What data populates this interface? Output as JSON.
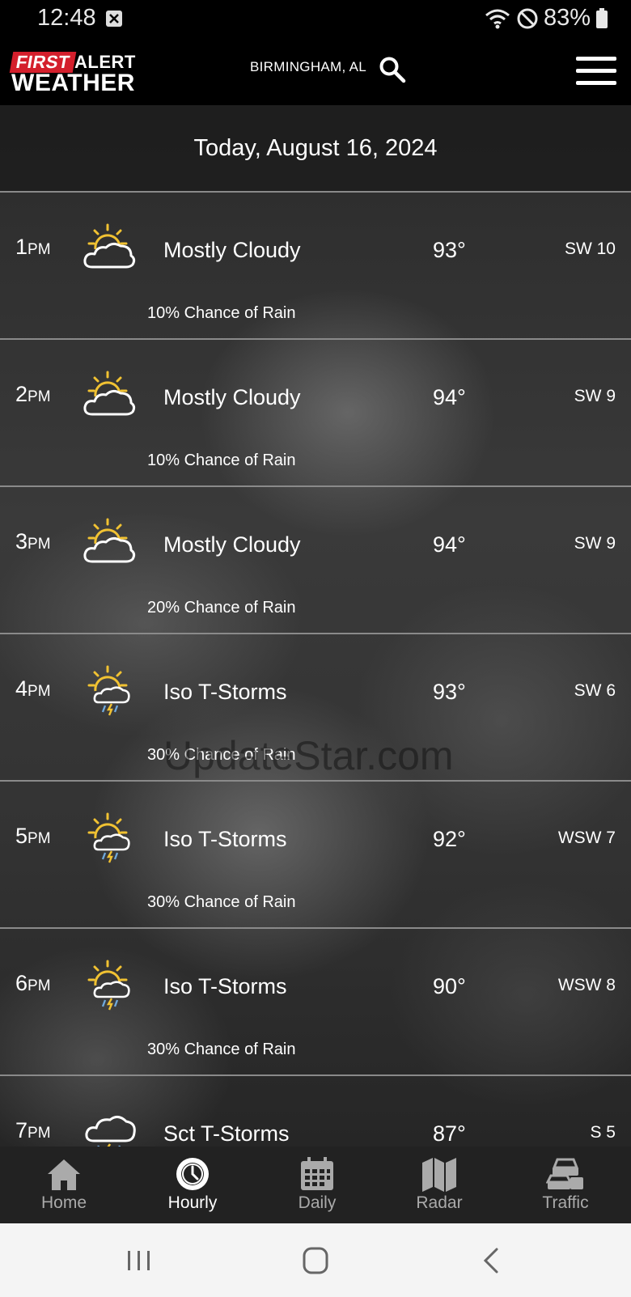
{
  "status": {
    "time": "12:48",
    "battery": "83%",
    "icons": [
      "notification-icon",
      "wifi-icon",
      "do-not-disturb-icon",
      "battery-icon"
    ]
  },
  "header": {
    "logo_first": "FIRST",
    "logo_alert": "ALERT",
    "logo_weather": "WEATHER",
    "location": "BIRMINGHAM, AL",
    "brand_color": "#d41f2c"
  },
  "date": "Today, August 16, 2024",
  "hours": [
    {
      "hour": "1",
      "ampm": "PM",
      "icon": "partly-cloudy-icon",
      "condition": "Mostly Cloudy",
      "temp": "93°",
      "wind": "SW 10",
      "rain": "10% Chance of Rain"
    },
    {
      "hour": "2",
      "ampm": "PM",
      "icon": "partly-cloudy-icon",
      "condition": "Mostly Cloudy",
      "temp": "94°",
      "wind": "SW 9",
      "rain": "10% Chance of Rain"
    },
    {
      "hour": "3",
      "ampm": "PM",
      "icon": "partly-cloudy-icon",
      "condition": "Mostly Cloudy",
      "temp": "94°",
      "wind": "SW 9",
      "rain": "20% Chance of Rain"
    },
    {
      "hour": "4",
      "ampm": "PM",
      "icon": "sun-thunderstorm-icon",
      "condition": "Iso T-Storms",
      "temp": "93°",
      "wind": "SW 6",
      "rain": "30% Chance of Rain"
    },
    {
      "hour": "5",
      "ampm": "PM",
      "icon": "sun-thunderstorm-icon",
      "condition": "Iso T-Storms",
      "temp": "92°",
      "wind": "WSW 7",
      "rain": "30% Chance of Rain"
    },
    {
      "hour": "6",
      "ampm": "PM",
      "icon": "sun-thunderstorm-icon",
      "condition": "Iso T-Storms",
      "temp": "90°",
      "wind": "WSW 8",
      "rain": "30% Chance of Rain"
    },
    {
      "hour": "7",
      "ampm": "PM",
      "icon": "thunderstorm-icon",
      "condition": "Sct T-Storms",
      "temp": "87°",
      "wind": "S 5",
      "rain": ""
    }
  ],
  "watermark": "UpdateStar.com",
  "nav": [
    {
      "label": "Home",
      "icon": "home-icon"
    },
    {
      "label": "Hourly",
      "icon": "clock-icon",
      "active": true
    },
    {
      "label": "Daily",
      "icon": "calendar-icon"
    },
    {
      "label": "Radar",
      "icon": "map-icon"
    },
    {
      "label": "Traffic",
      "icon": "traffic-icon"
    }
  ]
}
